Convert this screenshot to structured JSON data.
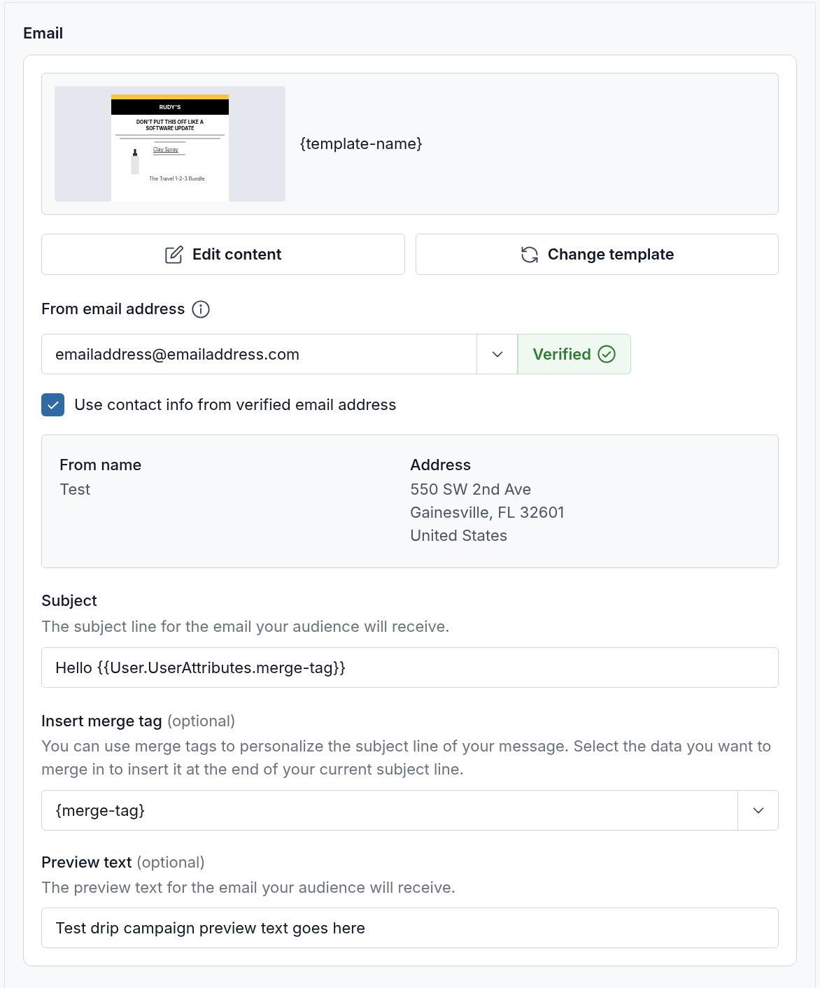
{
  "section": {
    "title": "Email"
  },
  "template": {
    "name": "{template-name}",
    "thumbnail": {
      "brand": "RUDY'S",
      "headline": "DON'T PUT THIS OFF LIKE A SOFTWARE UPDATE",
      "product": "Clay Spray",
      "next_product": "The Travel 1-2-3 Bundle"
    }
  },
  "buttons": [
    {
      "label": "Edit content",
      "kind": "edit"
    },
    {
      "label": "Change template",
      "kind": "change"
    }
  ],
  "from_email": {
    "label": "From email address",
    "value": "emailaddress@emailaddress.com",
    "status": "Verified",
    "verified": true
  },
  "use_contact_info": {
    "label": "Use contact info from verified email address",
    "checked": true
  },
  "contact": {
    "from_name_label": "From name",
    "from_name": "Test",
    "address_label": "Address",
    "address_lines": [
      "550 SW 2nd Ave",
      "Gainesville, FL 32601",
      "United States"
    ]
  },
  "subject": {
    "label": "Subject",
    "help": "The subject line for the email your audience will receive.",
    "value": "Hello {{User.UserAttributes.merge-tag}}"
  },
  "merge_tag": {
    "label": "Insert merge tag",
    "optional": "(optional)",
    "help": "You can use merge tags to personalize the subject line of your message. Select the data you want to merge in to insert it at the end of your current subject line.",
    "value": "{merge-tag}"
  },
  "preview_text": {
    "label": "Preview text",
    "optional": "(optional)",
    "help": "The preview text for the email your audience will receive.",
    "value": "Test drip campaign preview text goes here"
  }
}
